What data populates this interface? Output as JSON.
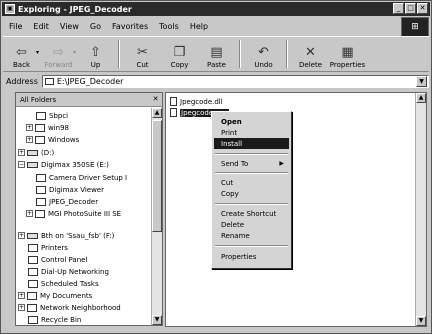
{
  "window": {
    "title": "Exploring - JPEG_Decoder",
    "controls": [
      "_",
      "□",
      "✕"
    ]
  },
  "menubar": [
    "File",
    "Edit",
    "View",
    "Go",
    "Favorites",
    "Tools",
    "Help"
  ],
  "toolbar": {
    "back": "Back",
    "forward": "Forward",
    "up": "Up",
    "cut": "Cut",
    "copy": "Copy",
    "paste": "Paste",
    "undo": "Undo",
    "delete": "Delete",
    "properties": "Properties"
  },
  "address": {
    "label": "Address",
    "value": "E:\\JPEG_Decoder"
  },
  "folders": {
    "header": "All Folders",
    "items": [
      {
        "label": "Sbpci",
        "pm": ""
      },
      {
        "label": "win98",
        "pm": "+"
      },
      {
        "label": "Windows",
        "pm": "+"
      },
      {
        "label": "(D:)",
        "pm": "+"
      },
      {
        "label": "Digimax 350SE (E:)",
        "pm": "−"
      },
      {
        "label": "Camera Driver Setup I",
        "pm": ""
      },
      {
        "label": "Digimax Viewer",
        "pm": ""
      },
      {
        "label": "JPEG_Decoder",
        "pm": ""
      },
      {
        "label": "MGI PhotoSuite III SE",
        "pm": "+"
      },
      {
        "label": "Bth on 'Ssau_fsb' (F:)",
        "pm": "+"
      },
      {
        "label": "Printers",
        "pm": ""
      },
      {
        "label": "Control Panel",
        "pm": ""
      },
      {
        "label": "Dial-Up Networking",
        "pm": ""
      },
      {
        "label": "Scheduled Tasks",
        "pm": ""
      },
      {
        "label": "My Documents",
        "pm": "+"
      },
      {
        "label": "Network Neighborhood",
        "pm": "+"
      },
      {
        "label": "Recycle Bin",
        "pm": ""
      }
    ]
  },
  "files": [
    {
      "name": "Jpegcode.dll"
    },
    {
      "name": "Jpegcode.exe"
    }
  ],
  "context_menu": {
    "open": "Open",
    "print": "Print",
    "install": "Install",
    "send_to": "Send To",
    "cut": "Cut",
    "copy": "Copy",
    "create_shortcut": "Create Shortcut",
    "delete": "Delete",
    "rename": "Rename",
    "properties": "Properties"
  }
}
